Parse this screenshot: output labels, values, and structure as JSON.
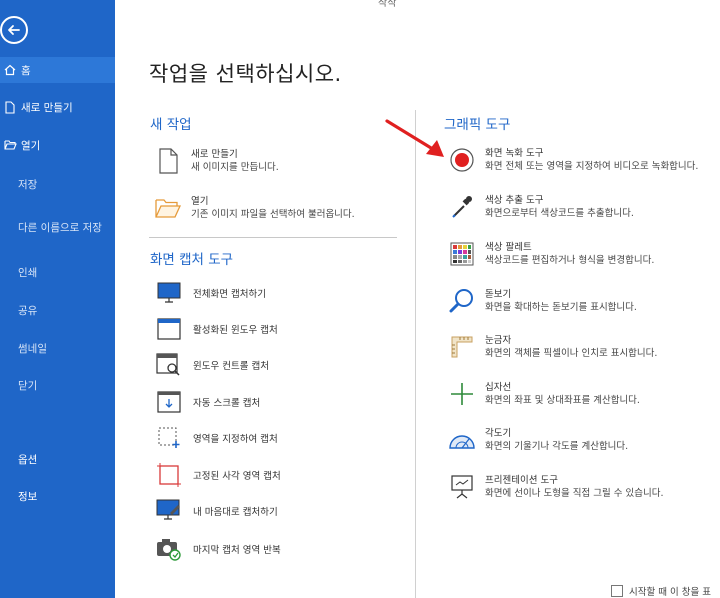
{
  "window": {
    "title": "작작"
  },
  "sidebar": {
    "nav": [
      {
        "label": "홈"
      },
      {
        "label": "새로 만들기"
      },
      {
        "label": "열기"
      },
      {
        "label": "저장"
      },
      {
        "label": "다른 이름으로 저장"
      },
      {
        "label": "인쇄"
      },
      {
        "label": "공유"
      },
      {
        "label": "썸네일"
      },
      {
        "label": "닫기"
      },
      {
        "label": "옵션"
      },
      {
        "label": "정보"
      }
    ]
  },
  "main": {
    "title": "작업을 선택하십시오.",
    "new_work": {
      "title": "새 작업",
      "items": [
        {
          "title": "새로 만들기",
          "desc": "새 이미지를 만듭니다."
        },
        {
          "title": "열기",
          "desc": "기존 이미지 파일을 선택하여 불러옵니다."
        }
      ]
    },
    "capture": {
      "title": "화면 캡처 도구",
      "items": [
        {
          "label": "전체화면 캡처하기"
        },
        {
          "label": "활성화된 윈도우 캡처"
        },
        {
          "label": "윈도우 컨트롤 캡처"
        },
        {
          "label": "자동 스크롤 캡처"
        },
        {
          "label": "영역을 지정하여 캡처"
        },
        {
          "label": "고정된 사각 영역 캡처"
        },
        {
          "label": "내 마음대로 캡처하기"
        },
        {
          "label": "마지막 캡처 영역 반복"
        }
      ]
    },
    "graphics": {
      "title": "그래픽 도구",
      "items": [
        {
          "title": "화면 녹화 도구",
          "desc": "화면 전체 또는 영역을 지정하여 비디오로 녹화합니다."
        },
        {
          "title": "색상 추출 도구",
          "desc": "화면으로부터 색상코드를 추출합니다."
        },
        {
          "title": "색상 팔레트",
          "desc": "색상코드를 편집하거나 형식을 변경합니다."
        },
        {
          "title": "돋보기",
          "desc": "화면을 확대하는 돋보기를 표시합니다."
        },
        {
          "title": "눈금자",
          "desc": "화면의 객체를 픽셀이나 인치로 표시합니다."
        },
        {
          "title": "십자선",
          "desc": "화면의 좌표 및 상대좌표를 계산합니다."
        },
        {
          "title": "각도기",
          "desc": "화면의 기울기나 각도를 계산합니다."
        },
        {
          "title": "프리젠테이션 도구",
          "desc": "화면에 선이나 도형을 직접 그릴 수 있습니다."
        }
      ]
    },
    "footer": {
      "checkbox_label": "시작할 때 이 창을 표"
    }
  },
  "colors": {
    "sidebar": "#1f66c8",
    "accent": "#1f66c8",
    "arrow": "#e02020",
    "record": "#e02020"
  }
}
